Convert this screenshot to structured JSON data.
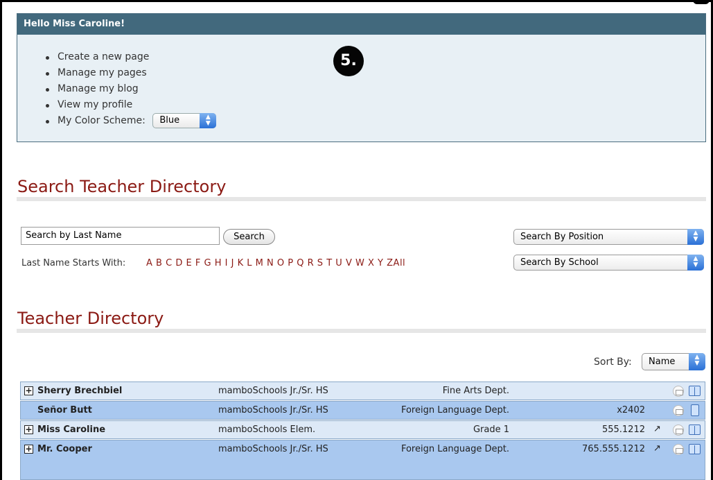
{
  "welcome": {
    "greeting": "Hello Miss Caroline!",
    "links": [
      "Create a new page",
      "Manage my pages",
      "Manage my blog",
      "View my profile"
    ],
    "color_scheme_label": "My Color Scheme:",
    "color_scheme_value": "Blue",
    "step_number": "5."
  },
  "search": {
    "title": "Search Teacher Directory",
    "input_value": "Search by Last Name",
    "button_label": "Search",
    "letters_label": "Last Name Starts With:",
    "letters": [
      "A",
      "B",
      "C",
      "D",
      "E",
      "F",
      "G",
      "H",
      "I",
      "J",
      "K",
      "L",
      "M",
      "N",
      "O",
      "P",
      "Q",
      "R",
      "S",
      "T",
      "U",
      "V",
      "W",
      "X",
      "Y",
      "Z",
      "All"
    ],
    "position_select": "Search By Position",
    "school_select": "Search By School"
  },
  "directory": {
    "title": "Teacher Directory",
    "sort_label": "Sort By:",
    "sort_value": "Name",
    "rows": [
      {
        "name": "Sherry Brechbiel",
        "school": "mamboSchools Jr./Sr. HS",
        "dept": "Fine Arts Dept.",
        "phone": "",
        "expandable": true,
        "ext_link": false,
        "book": "book"
      },
      {
        "name": "Señor Butt",
        "school": "mamboSchools Jr./Sr. HS",
        "dept": "Foreign Language Dept.",
        "phone": "x2402",
        "expandable": false,
        "ext_link": false,
        "book": "doc"
      },
      {
        "name": "Miss Caroline",
        "school": "mamboSchools Elem.",
        "dept": "Grade 1",
        "phone": "555.1212",
        "expandable": true,
        "ext_link": true,
        "book": "book"
      },
      {
        "name": "Mr. Cooper",
        "school": "mamboSchools Jr./Sr. HS",
        "dept": "Foreign Language Dept.",
        "phone": "765.555.1212",
        "expandable": true,
        "ext_link": true,
        "book": "book"
      }
    ]
  },
  "icons": {
    "expand": "plus-box-icon",
    "external": "external-link-icon",
    "mail": "email-icon",
    "book": "open-book-icon",
    "doc": "document-icon",
    "stepper": "up-down-arrows-icon"
  },
  "colors": {
    "header_bg": "#42697d",
    "panel_bg": "#e8f0f5",
    "heading_red": "#8b1a14",
    "row_light": "#dde9f7",
    "row_dark": "#a9c8ef"
  }
}
